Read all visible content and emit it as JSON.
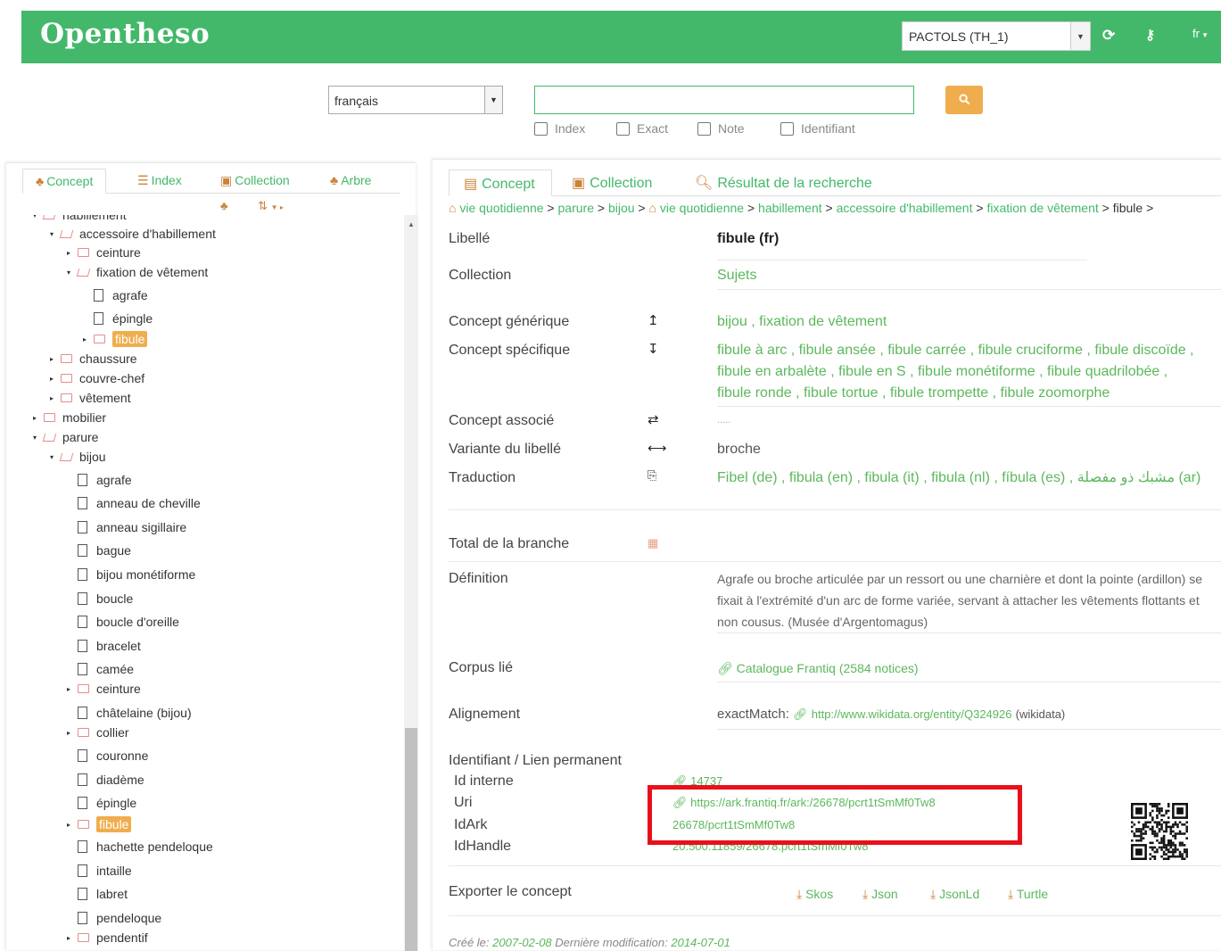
{
  "header": {
    "logo": "Opentheso",
    "thesaurus": "PACTOLS (TH_1)",
    "lang_menu": "fr"
  },
  "search": {
    "language": "français",
    "value": "",
    "options": [
      "Index",
      "Exact",
      "Note",
      "Identifiant"
    ]
  },
  "left_tabs": [
    "Concept",
    "Index",
    "Collection",
    "Arbre"
  ],
  "tree": [
    {
      "label": "habillement",
      "level": 1,
      "type": "folder-open",
      "toggle": "▾"
    },
    {
      "label": "accessoire d'habillement",
      "level": 2,
      "type": "folder-open",
      "toggle": "▾"
    },
    {
      "label": "ceinture",
      "level": 3,
      "type": "folder",
      "toggle": "▸"
    },
    {
      "label": "fixation de vêtement",
      "level": 3,
      "type": "folder-open",
      "toggle": "▾"
    },
    {
      "label": "agrafe",
      "level": 4,
      "type": "file",
      "toggle": ""
    },
    {
      "label": "épingle",
      "level": 4,
      "type": "file",
      "toggle": ""
    },
    {
      "label": "fibule",
      "level": 4,
      "type": "folder",
      "toggle": "▸",
      "selected": true
    },
    {
      "label": "chaussure",
      "level": 2,
      "type": "folder",
      "toggle": "▸"
    },
    {
      "label": "couvre-chef",
      "level": 2,
      "type": "folder",
      "toggle": "▸"
    },
    {
      "label": "vêtement",
      "level": 2,
      "type": "folder",
      "toggle": "▸"
    },
    {
      "label": "mobilier",
      "level": 1,
      "type": "folder",
      "toggle": "▸"
    },
    {
      "label": "parure",
      "level": 1,
      "type": "folder-open",
      "toggle": "▾"
    },
    {
      "label": "bijou",
      "level": 2,
      "type": "folder-open",
      "toggle": "▾"
    },
    {
      "label": "agrafe",
      "level": 3,
      "type": "file",
      "toggle": ""
    },
    {
      "label": "anneau de cheville",
      "level": 3,
      "type": "file",
      "toggle": ""
    },
    {
      "label": "anneau sigillaire",
      "level": 3,
      "type": "file",
      "toggle": ""
    },
    {
      "label": "bague",
      "level": 3,
      "type": "file",
      "toggle": ""
    },
    {
      "label": "bijou monétiforme",
      "level": 3,
      "type": "file",
      "toggle": ""
    },
    {
      "label": "boucle",
      "level": 3,
      "type": "file",
      "toggle": ""
    },
    {
      "label": "boucle d'oreille",
      "level": 3,
      "type": "file",
      "toggle": ""
    },
    {
      "label": "bracelet",
      "level": 3,
      "type": "file",
      "toggle": ""
    },
    {
      "label": "camée",
      "level": 3,
      "type": "file",
      "toggle": ""
    },
    {
      "label": "ceinture",
      "level": 3,
      "type": "folder",
      "toggle": "▸"
    },
    {
      "label": "châtelaine (bijou)",
      "level": 3,
      "type": "file",
      "toggle": ""
    },
    {
      "label": "collier",
      "level": 3,
      "type": "folder",
      "toggle": "▸"
    },
    {
      "label": "couronne",
      "level": 3,
      "type": "file",
      "toggle": ""
    },
    {
      "label": "diadème",
      "level": 3,
      "type": "file",
      "toggle": ""
    },
    {
      "label": "épingle",
      "level": 3,
      "type": "file",
      "toggle": ""
    },
    {
      "label": "fibule",
      "level": 3,
      "type": "folder",
      "toggle": "▸",
      "selected": true
    },
    {
      "label": "hachette pendeloque",
      "level": 3,
      "type": "file",
      "toggle": ""
    },
    {
      "label": "intaille",
      "level": 3,
      "type": "file",
      "toggle": ""
    },
    {
      "label": "labret",
      "level": 3,
      "type": "file",
      "toggle": ""
    },
    {
      "label": "pendeloque",
      "level": 3,
      "type": "file",
      "toggle": ""
    },
    {
      "label": "pendentif",
      "level": 3,
      "type": "folder",
      "toggle": "▸"
    }
  ],
  "right_tabs": [
    "Concept",
    "Collection",
    "Résultat de la recherche"
  ],
  "breadcrumb": [
    "vie quotidienne",
    "parure",
    "bijou",
    "vie quotidienne",
    "habillement",
    "accessoire d'habillement",
    "fixation de vêtement",
    "fibule"
  ],
  "concept": {
    "libelle_label": "Libellé",
    "libelle": "fibule (fr)",
    "collection_label": "Collection",
    "collection": "Sujets",
    "generique_label": "Concept générique",
    "generique": "bijou , fixation de vêtement",
    "specifique_label": "Concept spécifique",
    "specifique_lines": [
      "fibule à arc , fibule ansée , fibule carrée , fibule cruciforme , fibule discoïde ,",
      "fibule en arbalète , fibule en S , fibule monétiforme , fibule quadrilobée ,",
      "fibule ronde , fibule tortue , fibule trompette , fibule zoomorphe"
    ],
    "associe_label": "Concept associé",
    "associe": ".....",
    "variante_label": "Variante du libellé",
    "variante": "broche",
    "traduction_label": "Traduction",
    "traduction": "Fibel (de) , fibula (en) , fibula (it) , fibula (nl) , fíbula (es) , مشبك ذو مفصلة (ar)",
    "total_label": "Total de la branche",
    "definition_label": "Définition",
    "definition_lines": [
      "Agrafe ou broche articulée par un ressort ou une charnière et dont la pointe (ardillon) se",
      "fixait à l'extrémité d'un arc de forme variée, servant à attacher les vêtements flottants et",
      "non cousus. (Musée d'Argentomagus)"
    ],
    "corpus_label": "Corpus lié",
    "corpus": "Catalogue Frantiq (2584 notices)",
    "alignement_label": "Alignement",
    "alignement_prefix": "exactMatch:",
    "alignement_url": "http://www.wikidata.org/entity/Q324926",
    "alignement_suffix": "(wikidata)",
    "ident_label": "Identifiant / Lien permanent",
    "id_interne_label": "Id interne",
    "id_interne": "14737",
    "uri_label": "Uri",
    "uri": "https://ark.frantiq.fr/ark:/26678/pcrt1tSmMf0Tw8",
    "idark_label": "IdArk",
    "idark": "26678/pcrt1tSmMf0Tw8",
    "idhandle_label": "IdHandle",
    "idhandle": "20.500.11859/26678.pcrt1tSmMf0Tw8",
    "export_label": "Exporter le concept",
    "exports": [
      "Skos",
      "Json",
      "JsonLd",
      "Turtle"
    ],
    "cree_label": "Créé le:",
    "cree": "2007-02-08",
    "modif_label": "Dernière modification:",
    "modif": "2014-07-01"
  }
}
